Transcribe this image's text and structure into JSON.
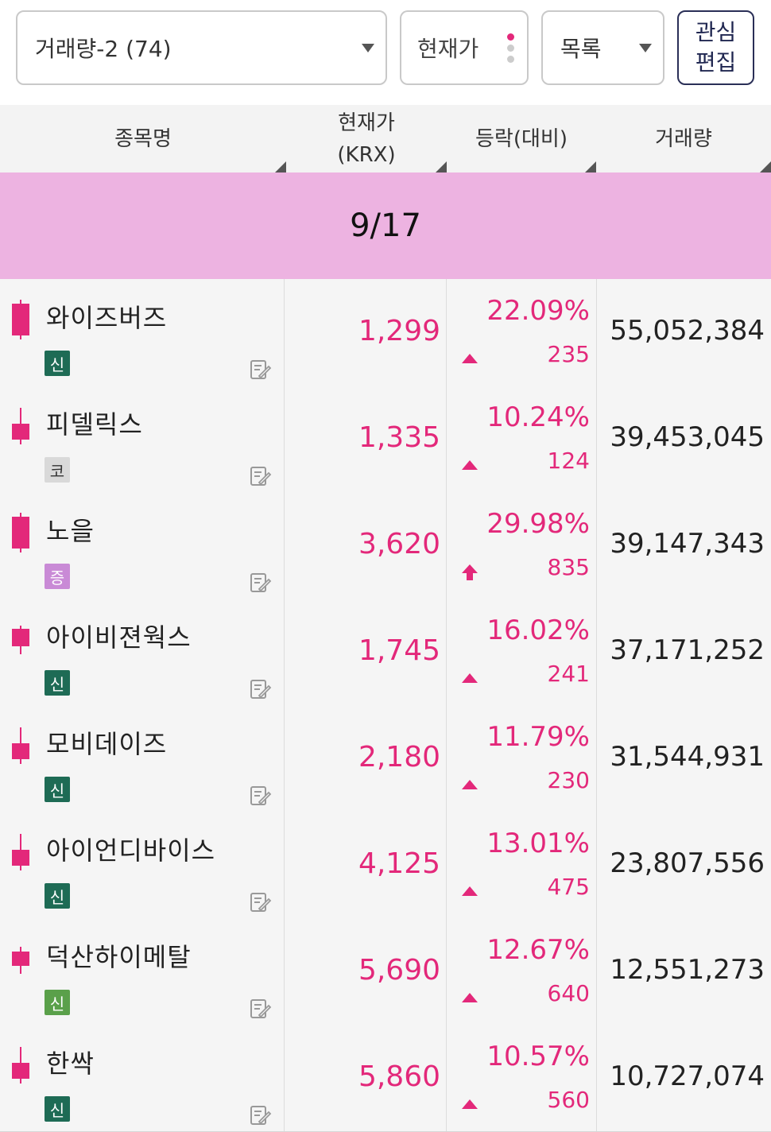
{
  "toolbar": {
    "group_label": "거래량-2 (74)",
    "sort_label": "현재가",
    "view_label": "목록",
    "edit_line1": "관심",
    "edit_line2": "편집"
  },
  "table": {
    "headers": {
      "name": "종목명",
      "price_line1": "현재가",
      "price_line2": "(KRX)",
      "change": "등락(대비)",
      "volume": "거래량"
    },
    "date": "9/17",
    "rows": [
      {
        "name": "와이즈버즈",
        "badge": "신",
        "badge_color": "#1e6b55",
        "price": "1,299",
        "rate": "22.09%",
        "diff": "235",
        "arrow": "up",
        "volume": "55,052,384",
        "candle": "full"
      },
      {
        "name": "피델릭스",
        "badge": "코",
        "badge_color": "#d9d9d9",
        "price": "1,335",
        "rate": "10.24%",
        "diff": "124",
        "arrow": "up",
        "volume": "39,453,045",
        "candle": "short"
      },
      {
        "name": "노을",
        "badge": "증",
        "badge_color": "#c98ad6",
        "price": "3,620",
        "rate": "29.98%",
        "diff": "835",
        "arrow": "limit",
        "volume": "39,147,343",
        "candle": "full"
      },
      {
        "name": "아이비젼웍스",
        "badge": "신",
        "badge_color": "#1e6b55",
        "price": "1,745",
        "rate": "16.02%",
        "diff": "241",
        "arrow": "up",
        "volume": "37,171,252",
        "candle": "mid"
      },
      {
        "name": "모비데이즈",
        "badge": "신",
        "badge_color": "#1e6b55",
        "price": "2,180",
        "rate": "11.79%",
        "diff": "230",
        "arrow": "up",
        "volume": "31,544,931",
        "candle": "short"
      },
      {
        "name": "아이언디바이스",
        "badge": "신",
        "badge_color": "#1e6b55",
        "price": "4,125",
        "rate": "13.01%",
        "diff": "475",
        "arrow": "up",
        "volume": "23,807,556",
        "candle": "short"
      },
      {
        "name": "덕산하이메탈",
        "badge": "신",
        "badge_color": "#5aa04a",
        "price": "5,690",
        "rate": "12.67%",
        "diff": "640",
        "arrow": "up",
        "volume": "12,551,273",
        "candle": "small"
      },
      {
        "name": "한싹",
        "badge": "신",
        "badge_color": "#1e6b55",
        "price": "5,860",
        "rate": "10.57%",
        "diff": "560",
        "arrow": "up",
        "volume": "10,727,074",
        "candle": "short"
      }
    ]
  },
  "colors": {
    "accent": "#e3287a",
    "banner": "#edb3e1",
    "header_bg": "#f3f3f3",
    "row_bg": "#f5f5f5"
  }
}
